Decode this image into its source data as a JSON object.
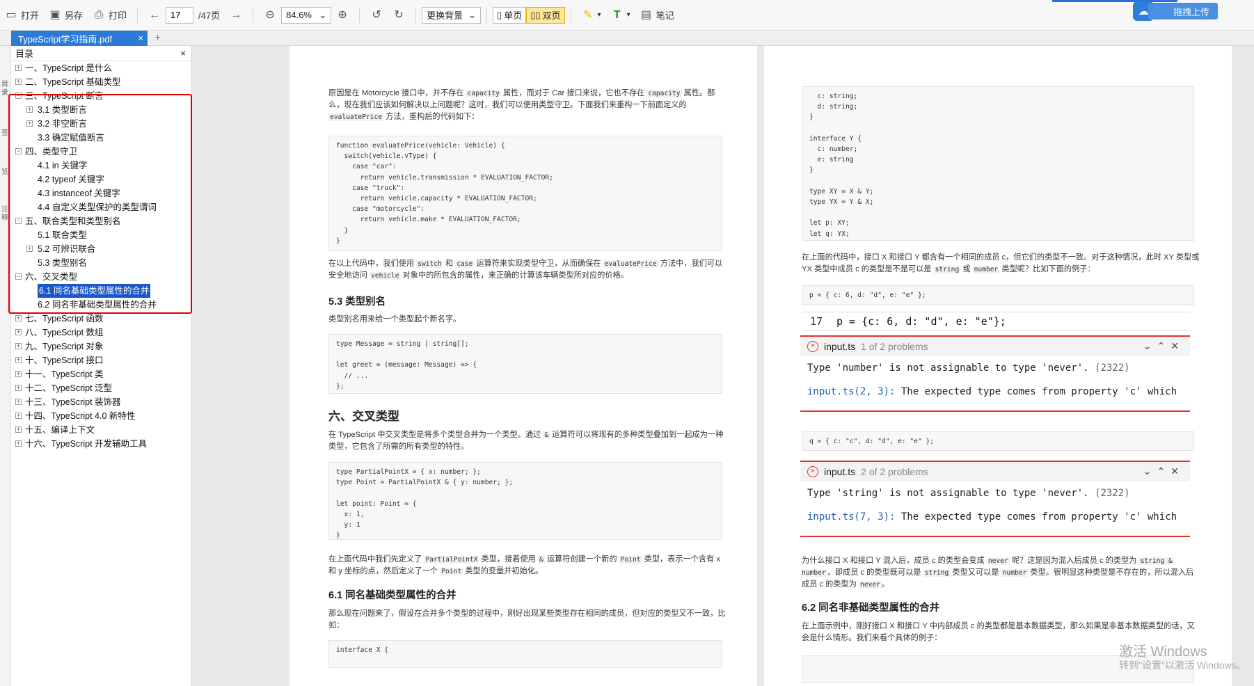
{
  "toolbar": {
    "open": "打开",
    "save_as": "另存",
    "print": "打印",
    "page_current": "17",
    "page_total": "/47页",
    "zoom": "84.6%",
    "background": "更换背景",
    "single_page": "单页",
    "double_page": "双页",
    "note": "笔记",
    "upload": "拖拽上传"
  },
  "tab": {
    "filename": "TypeScript学习指南.pdf",
    "close": "×",
    "add": "+"
  },
  "rail": [
    "目",
    "录",
    "签",
    "览",
    "注",
    "释"
  ],
  "sidebar": {
    "title": "目录",
    "close": "×",
    "items": [
      {
        "label": "一、TypeScript 是什么",
        "level": 0,
        "exp": "+"
      },
      {
        "label": "二、TypeScript 基础类型",
        "level": 0,
        "exp": "+"
      },
      {
        "label": "三、TypeScript 断言",
        "level": 0,
        "exp": "−"
      },
      {
        "label": "3.1 类型断言",
        "level": 1,
        "exp": "+"
      },
      {
        "label": "3.2 非空断言",
        "level": 1,
        "exp": "+"
      },
      {
        "label": "3.3 确定赋值断言",
        "level": 1,
        "exp": ""
      },
      {
        "label": "四、类型守卫",
        "level": 0,
        "exp": "−"
      },
      {
        "label": "4.1 in 关键字",
        "level": 1,
        "exp": ""
      },
      {
        "label": "4.2 typeof 关键字",
        "level": 1,
        "exp": ""
      },
      {
        "label": "4.3 instanceof 关键字",
        "level": 1,
        "exp": ""
      },
      {
        "label": "4.4 自定义类型保护的类型谓词",
        "level": 1,
        "exp": ""
      },
      {
        "label": "五、联合类型和类型别名",
        "level": 0,
        "exp": "−"
      },
      {
        "label": "5.1 联合类型",
        "level": 1,
        "exp": ""
      },
      {
        "label": "5.2 可辨识联合",
        "level": 1,
        "exp": "+"
      },
      {
        "label": "5.3 类型别名",
        "level": 1,
        "exp": ""
      },
      {
        "label": "六、交叉类型",
        "level": 0,
        "exp": "−"
      },
      {
        "label": "6.1 同名基础类型属性的合并",
        "level": 1,
        "exp": "",
        "selected": true
      },
      {
        "label": "6.2 同名非基础类型属性的合并",
        "level": 1,
        "exp": ""
      },
      {
        "label": "七、TypeScript 函数",
        "level": 0,
        "exp": "+"
      },
      {
        "label": "八、TypeScript 数组",
        "level": 0,
        "exp": "+"
      },
      {
        "label": "九、TypeScript 对象",
        "level": 0,
        "exp": "+"
      },
      {
        "label": "十、TypeScript 接口",
        "level": 0,
        "exp": "+"
      },
      {
        "label": "十一、TypeScript 类",
        "level": 0,
        "exp": "+"
      },
      {
        "label": "十二、TypeScript 泛型",
        "level": 0,
        "exp": "+"
      },
      {
        "label": "十三、TypeScript 装饰器",
        "level": 0,
        "exp": "+"
      },
      {
        "label": "十四、TypeScript 4.0 新特性",
        "level": 0,
        "exp": "+"
      },
      {
        "label": "十五、编译上下文",
        "level": 0,
        "exp": "+"
      },
      {
        "label": "十六、TypeScript 开发辅助工具",
        "level": 0,
        "exp": "+"
      }
    ]
  },
  "left_page": {
    "p1_a": "原因是在 Motorcycle 接口中，并不存在 ",
    "p1_code1": "capacity",
    "p1_b": " 属性，而对于 Car 接口来说，它也不存在 ",
    "p1_code2": "capacity",
    "p1_c": " 属性。那么，现在我们应该如何解决以上问题呢？这时，我们可以使用类型守卫。下面我们来重构一下前面定义的 ",
    "p1_code3": "evaluatePrice",
    "p1_d": " 方法，重构后的代码如下：",
    "code1": "function evaluatePrice(vehicle: Vehicle) {\n  switch(vehicle.vType) {\n    case \"car\":\n      return vehicle.transmission * EVALUATION_FACTOR;\n    case \"truck\":\n      return vehicle.capacity * EVALUATION_FACTOR;\n    case \"motorcycle\":\n      return vehicle.make * EVALUATION_FACTOR;\n  }\n}",
    "p2_a": "在以上代码中，我们使用 ",
    "p2_code1": "switch",
    "p2_b": " 和 ",
    "p2_code2": "case",
    "p2_c": " 运算符来实现类型守卫，从而确保在 ",
    "p2_code3": "evaluatePrice",
    "p2_d": " 方法中，我们可以安全地访问 ",
    "p2_code4": "vehicle",
    "p2_e": " 对象中的所包含的属性，来正确的计算该车辆类型所对应的价格。",
    "h_53": "5.3 类型别名",
    "p3": "类型别名用来给一个类型起个新名字。",
    "code2": "type Message = string | string[];\n\nlet greet = (message: Message) => {\n  // ...\n};",
    "h_6": "六、交叉类型",
    "p4_a": "在 TypeScript 中交叉类型是将多个类型合并为一个类型。通过 ",
    "p4_code1": "&",
    "p4_b": " 运算符可以将现有的多种类型叠加到一起成为一种类型，它包含了所需的所有类型的特性。",
    "code3": "type PartialPointX = { x: number; };\ntype Point = PartialPointX & { y: number; };\n\nlet point: Point = {\n  x: 1,\n  y: 1\n}",
    "p5_a": "在上面代码中我们先定义了 ",
    "p5_code1": "PartialPointX",
    "p5_b": " 类型，接着使用 ",
    "p5_code2": "&",
    "p5_c": " 运算符创建一个新的 ",
    "p5_code3": "Point",
    "p5_d": " 类型，表示一个含有 x 和 y 坐标的点，然后定义了一个 ",
    "p5_code4": "Point",
    "p5_e": " 类型的变量并初始化。",
    "h_61": "6.1 同名基础类型属性的合并",
    "p6": "那么现在问题来了，假设在合并多个类型的过程中，刚好出现某些类型存在相同的成员，但对应的类型又不一致，比如：",
    "code4": "interface X {"
  },
  "right_page": {
    "code1": "  c: string;\n  d: string;\n}\n\ninterface Y {\n  c: number;\n  e: string\n}\n\ntype XY = X & Y;\ntype YX = Y & X;\n\nlet p: XY;\nlet q: YX;",
    "p1_a": "在上面的代码中，接口 X 和接口 Y 都含有一个相同的成员 c，但它们的类型不一致。对于这种情况，此时 XY 类型或 YX 类型中成员 c 的类型是不是可以是 ",
    "p1_code1": "string",
    "p1_b": " 或 ",
    "p1_code2": "number",
    "p1_c": " 类型呢？比如下面的例子：",
    "code2": "p = { c: 6, d: \"d\", e: \"e\" };",
    "err1_line_no": "17",
    "err1_line_code": "p = {c: 6, d: \"d\", e: \"e\"};",
    "err1_file": "input.ts",
    "err1_count": "1 of 2 problems",
    "err1_msg": "Type 'number' is not assignable to type 'never'.",
    "err1_code": "(2322)",
    "err1_ref_link": "input.ts(2, 3):",
    "err1_ref_text": " The expected type comes from property 'c' which",
    "code3": "q = { c: \"c\", d: \"d\", e: \"e\" };",
    "err2_file": "input.ts",
    "err2_count": "2 of 2 problems",
    "err2_msg": "Type 'string' is not assignable to type 'never'.",
    "err2_code": "(2322)",
    "err2_ref_link": "input.ts(7, 3):",
    "err2_ref_text": " The expected type comes from property 'c' which",
    "p2_a": "为什么接口 X 和接口 Y 混入后，成员 c 的类型会变成 ",
    "p2_code1": "never",
    "p2_b": " 呢？这是因为混入后成员 c 的类型为 ",
    "p2_code2": "string & number",
    "p2_c": "，即成员 c 的类型既可以是 ",
    "p2_code3": "string",
    "p2_d": " 类型又可以是 ",
    "p2_code4": "number",
    "p2_e": " 类型。很明显这种类型是不存在的，所以混入后成员 c 的类型为 ",
    "p2_code5": "never",
    "p2_f": "。",
    "h_62": "6.2 同名非基础类型属性的合并",
    "p3": "在上面示例中，刚好接口 X 和接口 Y 中内部成员 c 的类型都是基本数据类型，那么如果是非基本数据类型的话，又会是什么情形。我们来看个具体的例子："
  },
  "watermark": {
    "line1": "激活 Windows",
    "line2": "转到\"设置\"以激活 Windows。"
  },
  "colors": {
    "accent": "#2b7bd6",
    "selection": "#1a57c9",
    "highlight_box": "#e00000",
    "error": "#e03030"
  }
}
